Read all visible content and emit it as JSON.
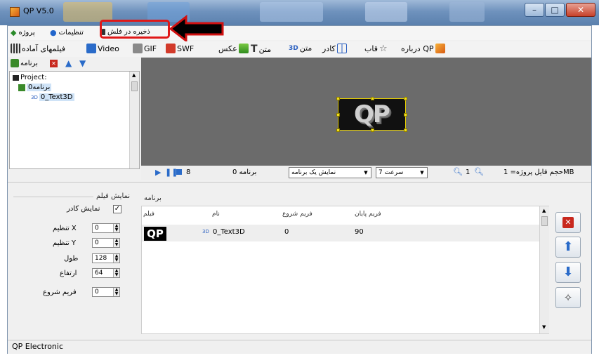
{
  "window": {
    "title": "QP  V5.0"
  },
  "menu": {
    "project": "پروژه",
    "settings": "تنظیمات",
    "save_flash": "ذخیره در فلش"
  },
  "toolbar": {
    "ready_films": "فیلمهای آماده",
    "video": "Video",
    "gif": "GIF",
    "swf": "SWF",
    "photo": "عکس",
    "text": "متن",
    "text3d": "متن",
    "frame": "کادر",
    "template": "قاب",
    "about": "درباره QP"
  },
  "tree": {
    "toolbar_label": "برنامه",
    "root": "Project:",
    "program": "برنامه0",
    "child": "0_Text3D"
  },
  "preview": {
    "logo": "QP"
  },
  "playbar": {
    "frame_num": "8",
    "program_label": "برنامه 0",
    "program_mode": "نمایش یک برنامه",
    "speed": "سرعت 7",
    "zoom": "1",
    "file_size": "حجم فایل پروژه= 1MB"
  },
  "film_settings": {
    "group": "نمایش فیلم",
    "show_frame": "نمایش کادر",
    "x_label": "تنظیم X",
    "x_value": "0",
    "y_label": "تنظیم Y",
    "y_value": "0",
    "width_label": "طول",
    "width_value": "128",
    "height_label": "ارتفاع",
    "height_value": "64",
    "start_label": "فریم شروع",
    "start_value": "0"
  },
  "program_table": {
    "group": "برنامه",
    "columns": [
      "فیلم",
      "نام",
      "فریم شروع",
      "فریم پایان"
    ],
    "rows": [
      {
        "thumb": "QP",
        "name": "0_Text3D",
        "start": "0",
        "end": "90"
      }
    ]
  },
  "status": {
    "text": "QP Electronic"
  },
  "colors": {
    "highlight": "#e01818",
    "preview_bg": "#6b6b6b",
    "selection": "#cfe3f7"
  }
}
